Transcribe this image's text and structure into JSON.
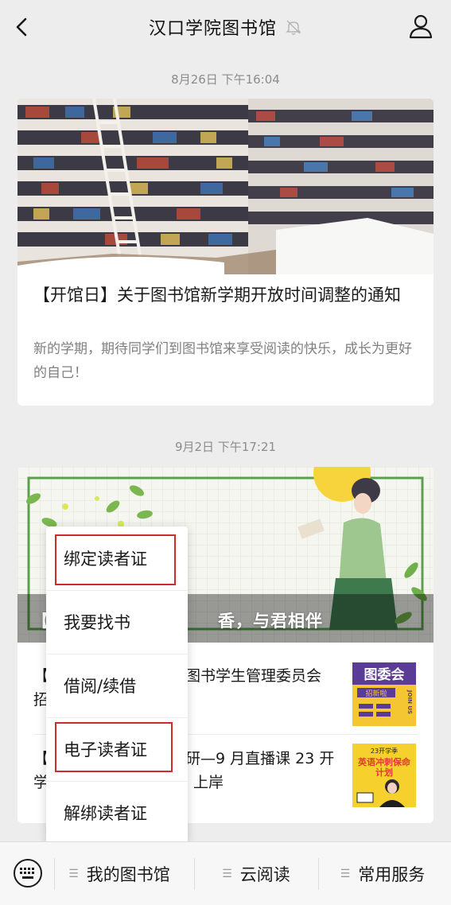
{
  "header": {
    "title": "汉口学院图书馆"
  },
  "feed": {
    "time1": "8月26日 下午16:04",
    "article1": {
      "title": "【开馆日】关于图书馆新学期开放时间调整的通知",
      "desc": "新的学期，期待同学们到图书馆来享受阅读的快乐，成长为更好的自己！"
    },
    "time2": "9月2日 下午17:21",
    "article2": {
      "cover_prefix": "【",
      "cover_title_tail": "香，与君相伴",
      "sub1_prefix": "【",
      "sub1_fragment_a": "图书学生管理委员会",
      "sub1_fragment_b": "招",
      "sub2_prefix": "【",
      "sub2_fragment_a": "研—9 月直播课 23 开",
      "sub2_fragment_b": "学",
      "sub2_fragment_c": "上岸"
    }
  },
  "thumbs": {
    "thumb1": {
      "big": "图委会",
      "tag": "招新啦",
      "side": "JOIN US"
    },
    "thumb2": {
      "line1": "23开学季",
      "line2": "英语冲刺保命",
      "line3": "计划"
    }
  },
  "menu": {
    "items": [
      "绑定读者证",
      "我要找书",
      "借阅/续借",
      "电子读者证",
      "解绑读者证"
    ]
  },
  "bottom_tabs": [
    "我的图书馆",
    "云阅读",
    "常用服务"
  ],
  "colors": {
    "highlight": "#d02a2a",
    "background": "#ededed"
  }
}
